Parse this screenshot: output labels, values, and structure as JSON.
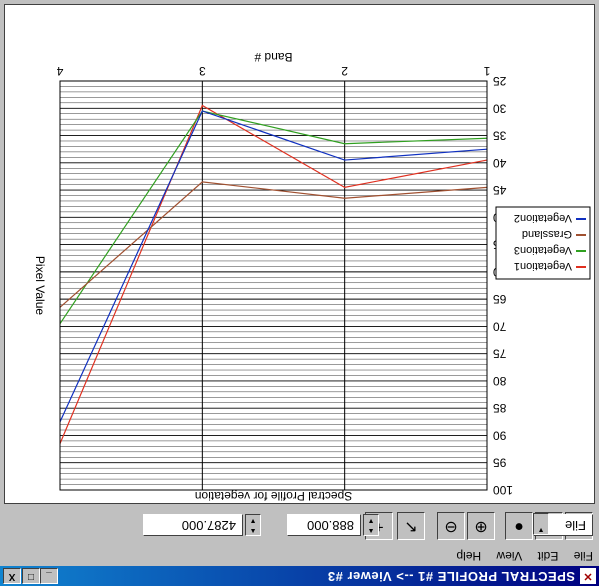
{
  "window": {
    "title": "SPECTRAL PROFILE #1 --> Viewer #3",
    "icon": "imagine-icon",
    "controls": [
      "_",
      "□",
      "X"
    ]
  },
  "menu": [
    "File",
    "Edit",
    "View",
    "Help"
  ],
  "toolbar": {
    "coord_x": "4287.000",
    "coord_y": "888.000",
    "output": "File",
    "icons": [
      "new-icon",
      "print-icon",
      "save-icon",
      "zoom-in-icon",
      "zoom-out-icon",
      "arrow-pointer-icon",
      "crosshair-icon"
    ]
  },
  "chart_data": {
    "type": "line",
    "title": "Spectral Profile for vegetation",
    "xlabel": "Band #",
    "ylabel": "Pixel Value",
    "x": [
      1,
      2,
      3,
      4
    ],
    "xticks": [
      "1",
      "2",
      "3",
      "4"
    ],
    "ylim": [
      25,
      100
    ],
    "yticks": [
      "25",
      "30",
      "35",
      "40",
      "45",
      "50",
      "55",
      "60",
      "65",
      "70",
      "75",
      "80",
      "85",
      "90",
      "95",
      "100"
    ],
    "grid": true,
    "legend_position": "right",
    "series": [
      {
        "name": "Vegetation1",
        "color": "#e03020",
        "values": [
          39.5,
          44.5,
          29.5,
          91.5
        ]
      },
      {
        "name": "Vegetation3",
        "color": "#30a020",
        "values": [
          35.5,
          36.5,
          30.5,
          69.5
        ]
      },
      {
        "name": "Grassland",
        "color": "#a05030",
        "values": [
          44.5,
          46.5,
          43.5,
          66.5
        ]
      },
      {
        "name": "Vegetation2",
        "color": "#1030c0",
        "values": [
          37.5,
          39.5,
          30.5,
          87.5
        ]
      }
    ]
  }
}
